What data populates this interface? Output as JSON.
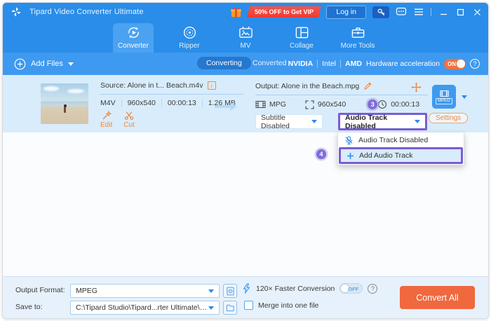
{
  "titlebar": {
    "app_title": "Tipard Video Converter Ultimate",
    "vip_badge": "50% OFF to Get VIP",
    "login_label": "Log in"
  },
  "tabs": [
    {
      "label": "Converter",
      "active": true
    },
    {
      "label": "Ripper",
      "active": false
    },
    {
      "label": "MV",
      "active": false
    },
    {
      "label": "Collage",
      "active": false
    },
    {
      "label": "More Tools",
      "active": false
    }
  ],
  "toolbar": {
    "add_files_label": "Add Files",
    "converting_label": "Converting",
    "converted_label": "Converted",
    "hw_nvidia": "NVIDIA",
    "hw_intel": "Intel",
    "hw_amd": "AMD",
    "hw_label": "Hardware acceleration",
    "hw_toggle": "ON"
  },
  "filerow": {
    "source": {
      "title": "Source: Alone in t... Beach.m4v",
      "format": "M4V",
      "resolution": "960x540",
      "duration": "00:00:13",
      "size": "1.26 MB",
      "edit_label": "Edit",
      "cut_label": "Cut"
    },
    "output": {
      "title": "Output: Alone in the Beach.mpg",
      "format": "MPG",
      "resolution": "960x540",
      "duration": "00:00:13",
      "step3": "3",
      "subtitle_value": "Subtitle Disabled",
      "audio_value": "Audio Track Disabled",
      "profile_label": "MPEG",
      "settings_label": "Settings"
    }
  },
  "audio_menu": {
    "item_disabled": "Audio Track Disabled",
    "item_add": "Add Audio Track",
    "step4": "4"
  },
  "bottombar": {
    "output_format_label": "Output Format:",
    "output_format_value": "MPEG",
    "save_to_label": "Save to:",
    "save_to_value": "C:\\Tipard Studio\\Tipard...rter Ultimate\\Converted",
    "faster_label": "120× Faster Conversion",
    "faster_toggle": "OFF",
    "merge_label": "Merge into one file",
    "convert_all_label": "Convert All"
  },
  "icons": {
    "logo": "pinwheel",
    "gift": "gift-box",
    "key": "license-key",
    "feedback": "speech-bubble",
    "menu": "hamburger",
    "window": [
      "minimize",
      "maximize",
      "close"
    ],
    "add_files": "plus-circle",
    "help": "question-circle",
    "info": "i-square",
    "edit": "magic-wand",
    "cut": "scissors",
    "rename": "pencil",
    "move": "move-arrows",
    "format": "film-strip",
    "resolution": "expand-corners",
    "duration": "clock",
    "audio_disabled": "mic-muted",
    "add_audio": "plus",
    "profile_pick": "file-gear",
    "folder": "open-folder",
    "faster": "lightning-bolt"
  },
  "colors": {
    "header_blue": "#2a8de9",
    "toolbar_blue": "#3e99f0",
    "active_tab_blue": "#4ba2f0",
    "row_light_blue": "#d9ecfb",
    "accent_orange": "#ef8a3d",
    "convert_orange": "#f0683e",
    "badge_red": "#f2453e",
    "annotation_purple": "#7a5cd6",
    "link_blue": "#2e8ae6"
  }
}
